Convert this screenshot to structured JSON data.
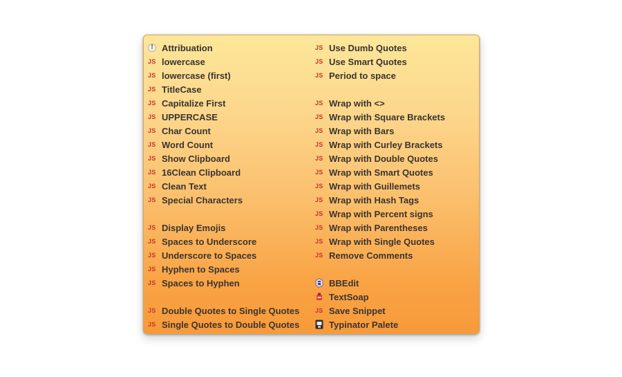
{
  "menu": {
    "left": [
      {
        "label": "Attribuation",
        "icon": "warning-icon"
      },
      {
        "label": "lowercase",
        "icon": "js-icon",
        "badge": "JS"
      },
      {
        "label": "lowercase (first)",
        "icon": "js-icon",
        "badge": "JS"
      },
      {
        "label": "TitleCase",
        "icon": "js-icon",
        "badge": "JS"
      },
      {
        "label": "Capitalize First",
        "icon": "js-icon",
        "badge": "JS"
      },
      {
        "label": "UPPERCASE",
        "icon": "js-icon",
        "badge": "JS"
      },
      {
        "label": "Char Count",
        "icon": "js-icon",
        "badge": "JS"
      },
      {
        "label": "Word Count",
        "icon": "js-icon",
        "badge": "JS"
      },
      {
        "label": "Show Clipboard",
        "icon": "js-icon",
        "badge": "JS"
      },
      {
        "label": "16Clean Clipboard",
        "icon": "js-icon",
        "badge": "JS"
      },
      {
        "label": "Clean Text",
        "icon": "js-icon",
        "badge": "JS"
      },
      {
        "label": "Special Characters",
        "icon": "js-icon",
        "badge": "JS"
      },
      {
        "label": "Display Emojis",
        "icon": "js-icon",
        "badge": "JS"
      },
      {
        "label": "Spaces to Underscore",
        "icon": "js-icon",
        "badge": "JS"
      },
      {
        "label": "Underscore to Spaces",
        "icon": "js-icon",
        "badge": "JS"
      },
      {
        "label": "Hyphen to Spaces",
        "icon": "js-icon",
        "badge": "JS"
      },
      {
        "label": "Spaces to Hyphen",
        "icon": "js-icon",
        "badge": "JS"
      },
      {
        "label": "Double Quotes to Single Quotes",
        "icon": "js-icon",
        "badge": "JS"
      },
      {
        "label": "Single Quotes to Double Quotes",
        "icon": "js-icon",
        "badge": "JS"
      }
    ],
    "right": [
      {
        "label": "Use Dumb Quotes",
        "icon": "js-icon",
        "badge": "JS"
      },
      {
        "label": "Use Smart Quotes",
        "icon": "js-icon",
        "badge": "JS"
      },
      {
        "label": "Period to space",
        "icon": "js-icon",
        "badge": "JS"
      },
      {
        "label": "Wrap with <>",
        "icon": "js-icon",
        "badge": "JS"
      },
      {
        "label": "Wrap with Square Brackets",
        "icon": "js-icon",
        "badge": "JS"
      },
      {
        "label": "Wrap with Bars",
        "icon": "js-icon",
        "badge": "JS"
      },
      {
        "label": "Wrap with Curley Brackets",
        "icon": "js-icon",
        "badge": "JS"
      },
      {
        "label": "Wrap with Double Quotes",
        "icon": "js-icon",
        "badge": "JS"
      },
      {
        "label": "Wrap with Smart Quotes",
        "icon": "js-icon",
        "badge": "JS"
      },
      {
        "label": "Wrap with Guillemets",
        "icon": "js-icon",
        "badge": "JS"
      },
      {
        "label": "Wrap with Hash Tags",
        "icon": "js-icon",
        "badge": "JS"
      },
      {
        "label": "Wrap with Percent signs",
        "icon": "js-icon",
        "badge": "JS"
      },
      {
        "label": "Wrap with Parentheses",
        "icon": "js-icon",
        "badge": "JS"
      },
      {
        "label": "Wrap with Single Quotes",
        "icon": "js-icon",
        "badge": "JS"
      },
      {
        "label": "Remove Comments",
        "icon": "js-icon",
        "badge": "JS"
      },
      {
        "label": "BBEdit",
        "icon": "bbedit-app-icon"
      },
      {
        "label": "TextSoap",
        "icon": "textsoap-app-icon"
      },
      {
        "label": "Save Snippet",
        "icon": "js-icon",
        "badge": "JS"
      },
      {
        "label": "Typinator Palete",
        "icon": "typinator-app-icon"
      }
    ]
  }
}
